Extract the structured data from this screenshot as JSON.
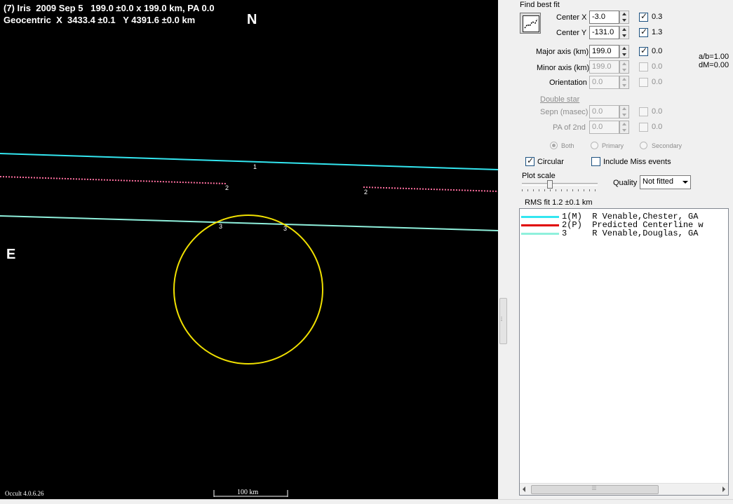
{
  "plot": {
    "title_line1": "(7) Iris  2009 Sep 5   199.0 ±0.0 x 199.0 km, PA 0.0",
    "title_line2": "Geocentric  X  3433.4 ±0.1   Y 4391.6 ±0.0 km",
    "north_label": "N",
    "east_label": "E",
    "version": "Occult 4.0.6.26",
    "scale_label": "100 km",
    "chord_labels": [
      "1",
      "2",
      "2",
      "3",
      "3"
    ],
    "colors": {
      "background": "#000000",
      "chord1": "#33e6f0",
      "chord2": "#ff6fa0",
      "chord3": "#8ff0dc",
      "ellipse": "#f0e000"
    }
  },
  "panel": {
    "find_best_fit": "Find best fit",
    "fit_button_icon": "chart-icon",
    "center_x": {
      "label": "Center X",
      "value": "-3.0",
      "checked": true,
      "uncert": "0.3"
    },
    "center_y": {
      "label": "Center Y",
      "value": "-131.0",
      "checked": true,
      "uncert": "1.3"
    },
    "major_axis": {
      "label": "Major axis (km)",
      "value": "199.0",
      "checked": true,
      "uncert": "0.0"
    },
    "minor_axis": {
      "label": "Minor axis (km)",
      "value": "199.0",
      "checked": false,
      "uncert": "0.0"
    },
    "orientation": {
      "label": "Orientation",
      "value": "0.0",
      "checked": false,
      "uncert": "0.0"
    },
    "ab_ratio": "a/b=1.00",
    "dm": "dM=0.00",
    "double_star": "Double star",
    "sepn": {
      "label": "Sepn (masec)",
      "value": "0.0",
      "checked": false,
      "uncert": "0.0"
    },
    "pa2nd": {
      "label": "PA of 2nd",
      "value": "0.0",
      "checked": false,
      "uncert": "0.0"
    },
    "radio_both": "Both",
    "radio_primary": "Primary",
    "radio_secondary": "Secondary",
    "circular": {
      "label": "Circular",
      "checked": true
    },
    "include_miss": {
      "label": "Include Miss events",
      "checked": false
    },
    "plot_scale": "Plot scale",
    "quality_label": "Quality",
    "quality_value": "Not fitted",
    "rms_fit": "RMS fit  1.2 ±0.1 km",
    "list": [
      {
        "text": "1(M)  R Venable,Chester, GA",
        "color": "#33e6f0"
      },
      {
        "text": "2(P)  Predicted Centerline w",
        "color": "#e00000"
      },
      {
        "text": "3     R Venable,Douglas, GA",
        "color": "#8ff0dc"
      }
    ]
  }
}
